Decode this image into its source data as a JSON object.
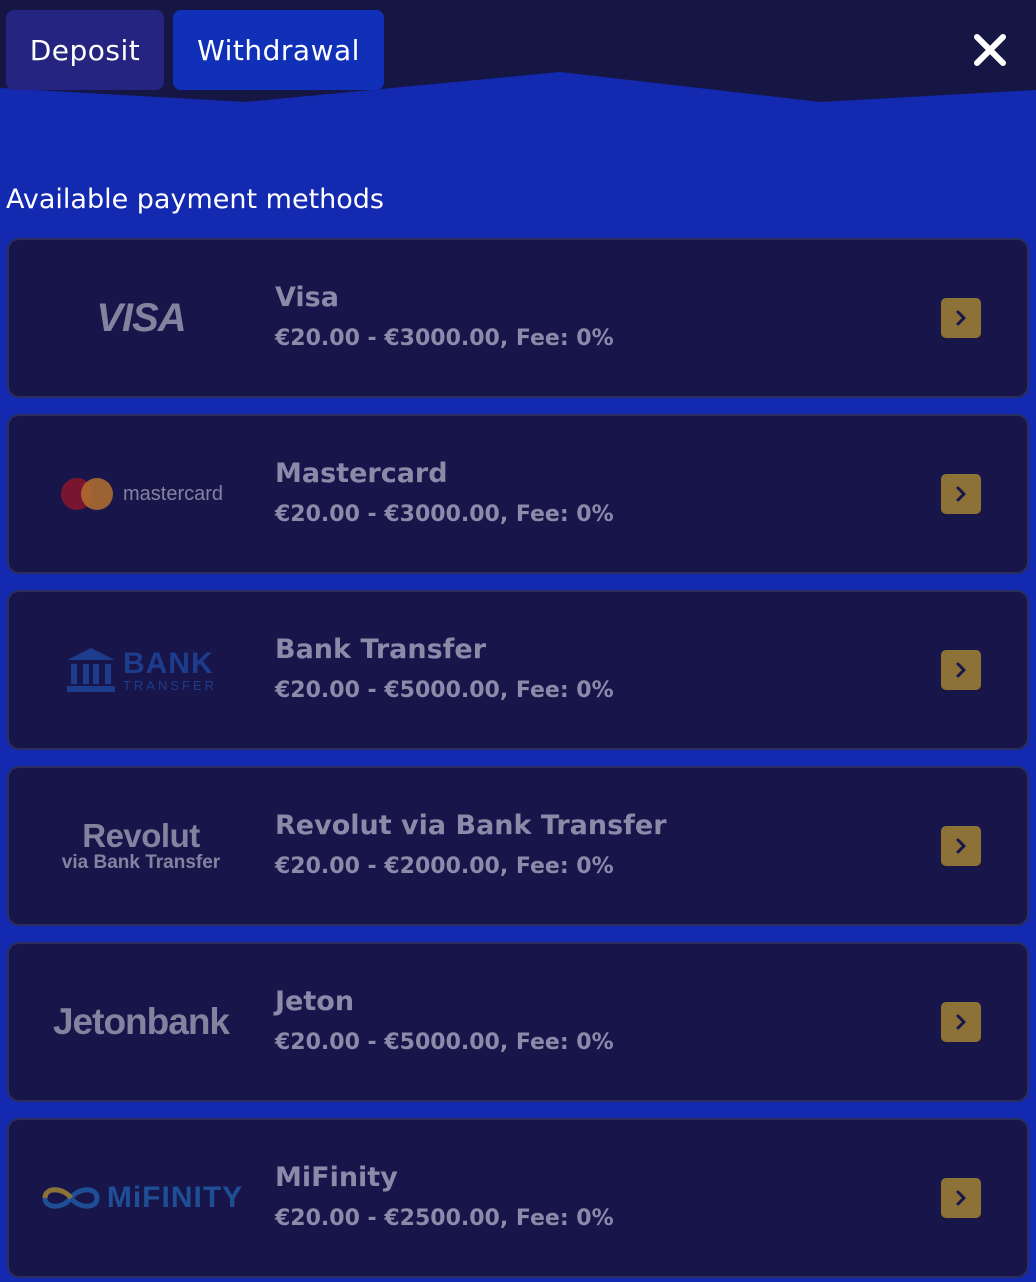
{
  "tabs": {
    "deposit": "Deposit",
    "withdrawal": "Withdrawal"
  },
  "section_label": "Available payment methods",
  "colors": {
    "page_bg": "#1229b0",
    "header_bg": "#161644",
    "card_bg": "#18154a",
    "arrow_bg": "#8c7237"
  },
  "methods": [
    {
      "name": "Visa",
      "range": "€20.00 - €3000.00, Fee: 0%",
      "logo_text": "VISA",
      "logo_icon": "visa-logo"
    },
    {
      "name": "Mastercard",
      "range": "€20.00 - €3000.00, Fee: 0%",
      "logo_text": "mastercard",
      "logo_icon": "mastercard-logo"
    },
    {
      "name": "Bank Transfer",
      "range": "€20.00 - €5000.00, Fee: 0%",
      "logo_text": "BANK",
      "logo_subtext": "TRANSFER",
      "logo_icon": "bank-building-icon"
    },
    {
      "name": "Revolut via Bank Transfer",
      "range": "€20.00 - €2000.00, Fee: 0%",
      "logo_text": "Revolut",
      "logo_subtext": "via Bank Transfer",
      "logo_icon": "revolut-logo"
    },
    {
      "name": "Jeton",
      "range": "€20.00 - €5000.00, Fee: 0%",
      "logo_text": "Jetonbank",
      "logo_icon": "jetonbank-logo"
    },
    {
      "name": "MiFinity",
      "range": "€20.00 - €2500.00, Fee: 0%",
      "logo_text": "MiFINITY",
      "logo_icon": "mifinity-logo"
    }
  ]
}
